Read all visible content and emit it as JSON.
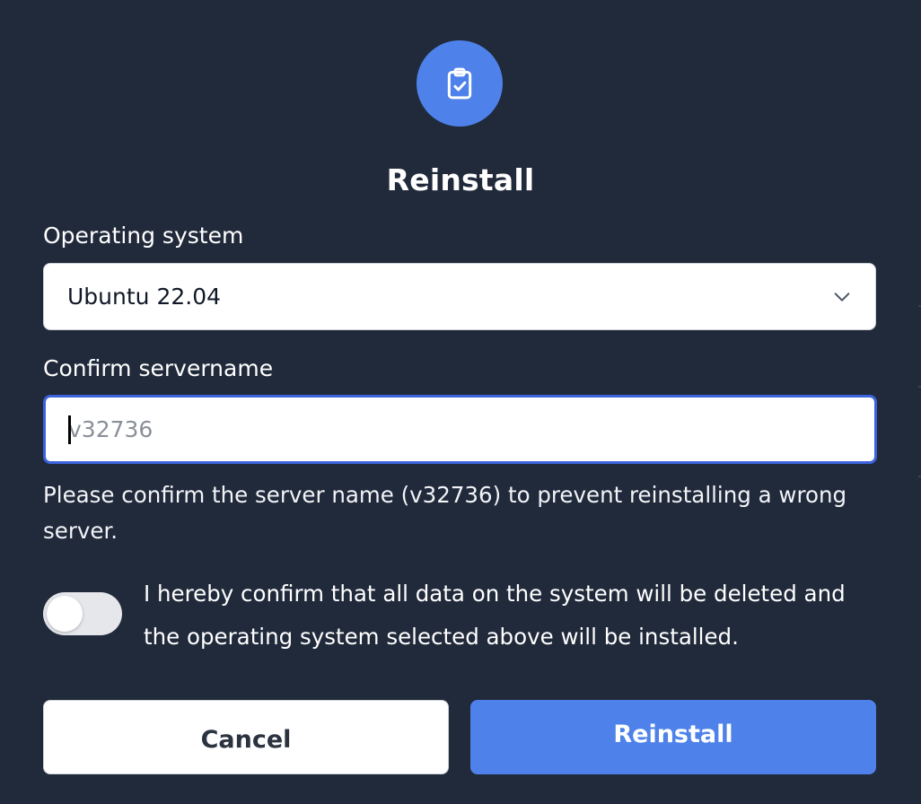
{
  "modal": {
    "title": "Reinstall",
    "header_icon": "clipboard-check-icon",
    "colors": {
      "background": "#212a3b",
      "accent": "#4e82ea",
      "focus_border": "#3b63dc"
    }
  },
  "os_field": {
    "label": "Operating system",
    "selected": "Ubuntu 22.04"
  },
  "servername_field": {
    "label": "Confirm servername",
    "value": "",
    "placeholder": "v32736",
    "help": "Please confirm the server name (v32736) to prevent reinstalling a wrong server."
  },
  "confirm_toggle": {
    "checked": false,
    "text": "I hereby confirm that all data on the system will be deleted and the operating system selected above will be installed."
  },
  "actions": {
    "cancel_label": "Cancel",
    "submit_label": "Reinstall"
  }
}
